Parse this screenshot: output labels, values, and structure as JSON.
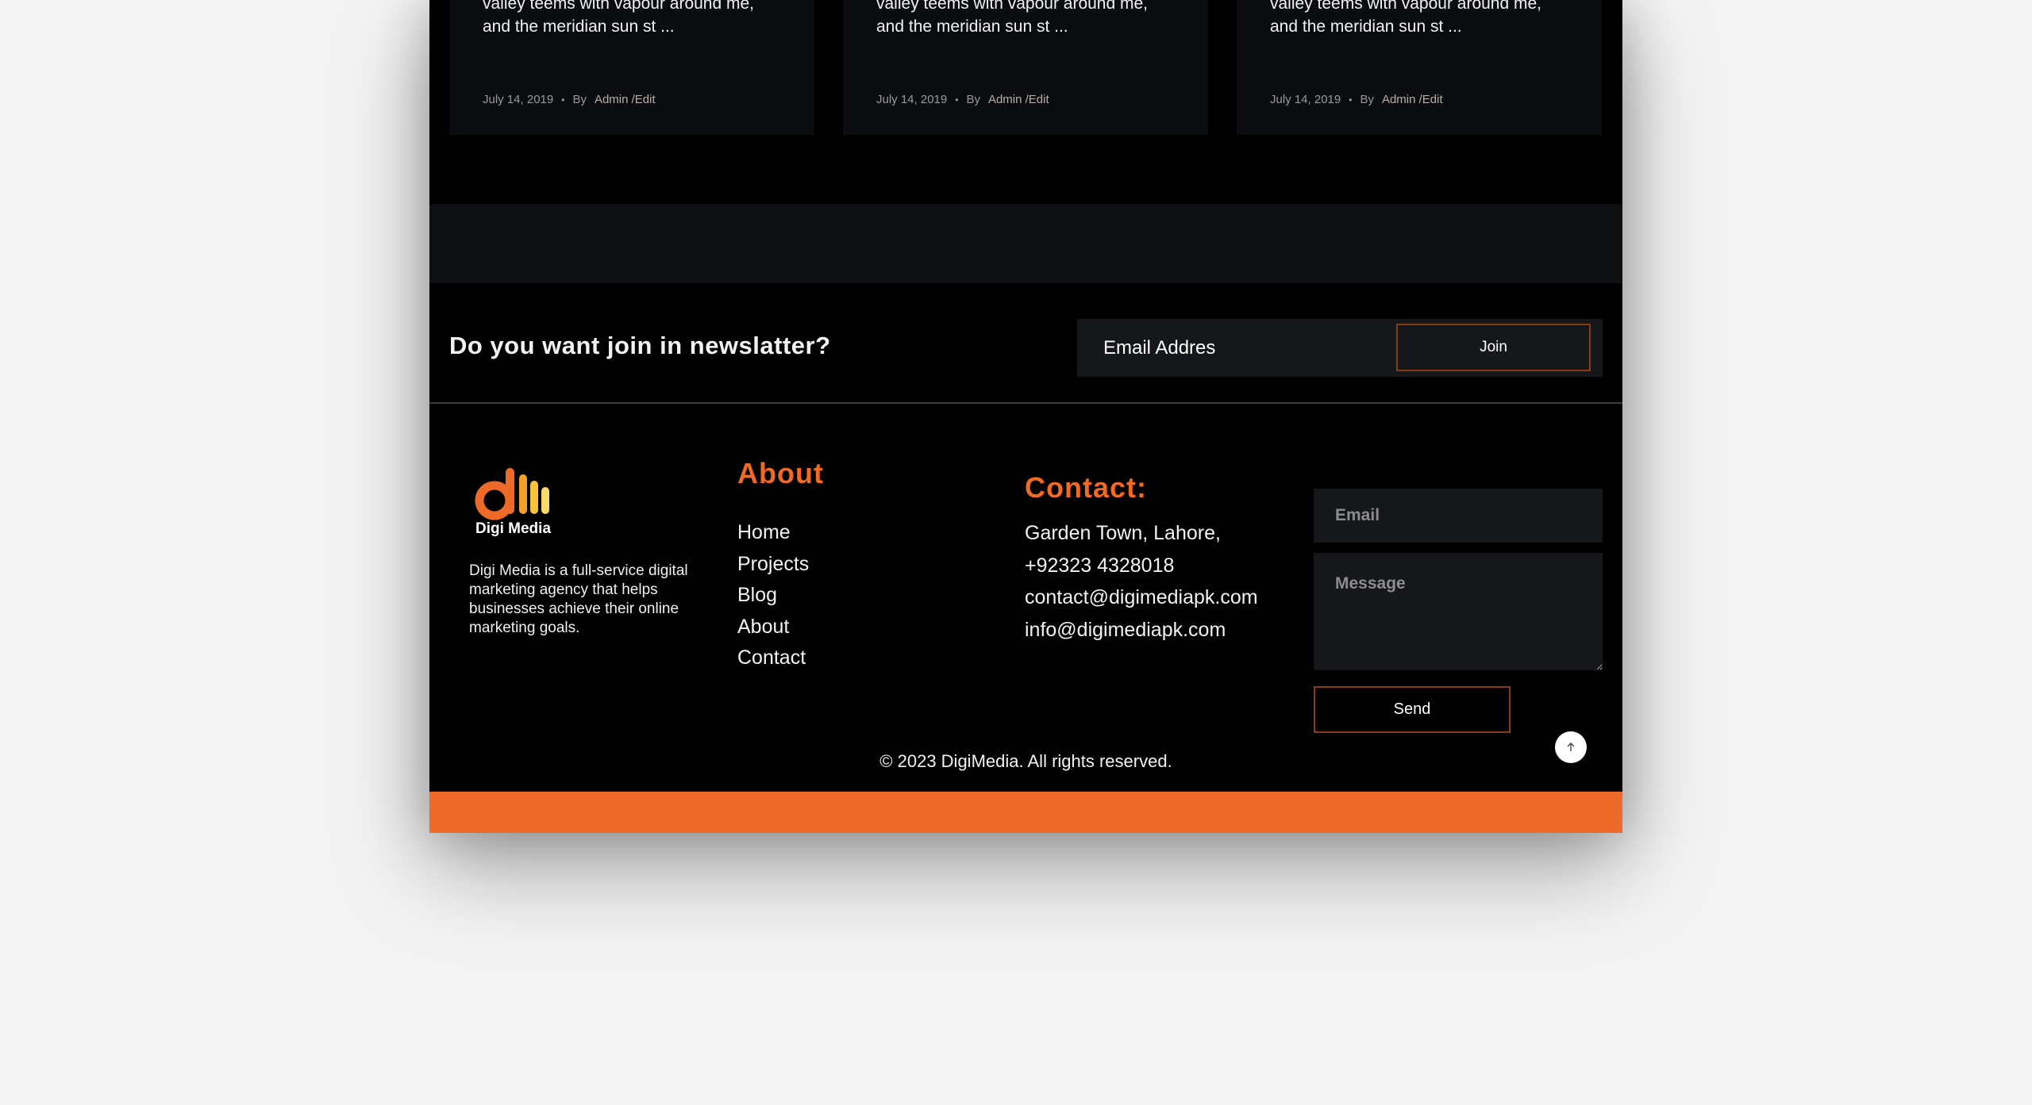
{
  "blog_cards": [
    {
      "excerpt": "valley teems with vapour around me,\nand the meridian sun st ...",
      "date": "July 14, 2019",
      "by_prefix": "By",
      "author_link": "Admin /Edit"
    },
    {
      "excerpt": "valley teems with vapour around me,\nand the meridian sun st ...",
      "date": "July 14, 2019",
      "by_prefix": "By",
      "author_link": "Admin /Edit"
    },
    {
      "excerpt": "valley teems with vapour around me,\nand the meridian sun st ...",
      "date": "July 14, 2019",
      "by_prefix": "By",
      "author_link": "Admin /Edit"
    }
  ],
  "newsletter": {
    "title": "Do you want join in newslatter?",
    "email_placeholder": "Email Addres",
    "join_label": "Join"
  },
  "footer": {
    "logo_text": "Digi Media",
    "about_text": "Digi Media is a full-service digital marketing agency that helps businesses achieve their online marketing goals.",
    "about_title": "About",
    "links": [
      "Home",
      "Projects",
      "Blog",
      "About",
      "Contact"
    ],
    "contact_title": "Contact:",
    "contact_lines": [
      "Garden Town, Lahore,",
      "+92323 4328018",
      "contact@digimediapk.com",
      "info@digimediapk.com"
    ],
    "form": {
      "email_placeholder": "Email",
      "message_placeholder": "Message",
      "send_label": "Send"
    },
    "copyright": "© 2023 DigiMedia. All rights reserved.",
    "scroll_top_icon": "arrow-up-icon"
  },
  "colors": {
    "accent": "#ee6a28",
    "background": "#000000",
    "card": "#0b0c10",
    "page_backdrop": "#f4f4f4"
  }
}
